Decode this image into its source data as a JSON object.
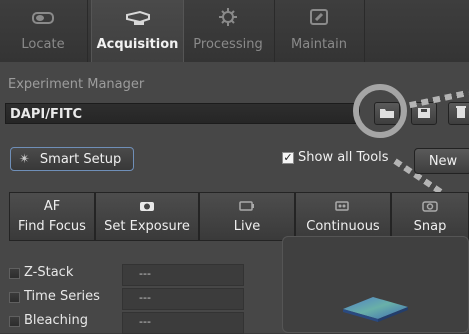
{
  "tabs": [
    {
      "label": "Locate",
      "icon": "locate-icon"
    },
    {
      "label": "Acquisition",
      "icon": "acquisition-icon",
      "active": true
    },
    {
      "label": "Processing",
      "icon": "processing-icon"
    },
    {
      "label": "Maintain",
      "icon": "maintain-icon"
    }
  ],
  "experiment": {
    "header": "Experiment Manager",
    "current": "DAPI/FITC"
  },
  "setup": {
    "smart_setup_label": "Smart Setup",
    "show_all_tools_label": "Show all Tools",
    "show_all_tools_checked": true,
    "new_label": "New"
  },
  "actions": [
    {
      "top": "AF",
      "bottom": "Find Focus"
    },
    {
      "top_icon": "camera-icon",
      "bottom": "Set Exposure"
    },
    {
      "top_icon": "live-icon",
      "bottom": "Live"
    },
    {
      "top_icon": "continuous-icon",
      "bottom": "Continuous"
    },
    {
      "top_icon": "snap-icon",
      "bottom": "Snap"
    }
  ],
  "options": [
    {
      "label": "Z-Stack",
      "value": "---"
    },
    {
      "label": "Time Series",
      "value": "---"
    },
    {
      "label": "Bleaching",
      "value": "---"
    }
  ],
  "colors": {
    "panel_bg": "#474747",
    "tab_bg": "#3a3a3a",
    "highlight_circle": "#a5a5a5",
    "smart_setup_border": "#6f8fb8"
  }
}
